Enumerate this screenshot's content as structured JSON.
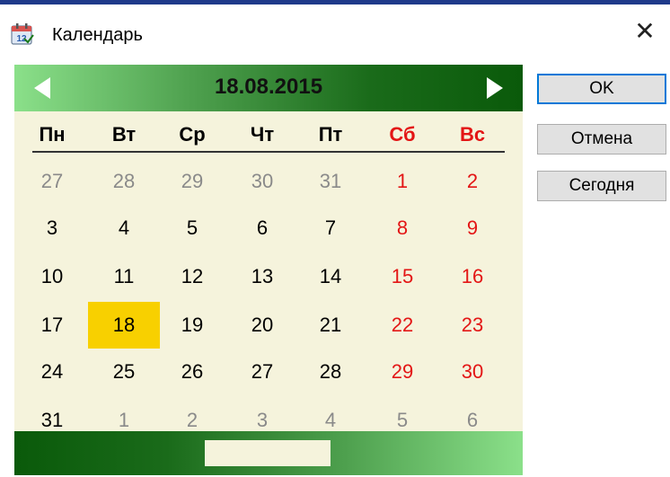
{
  "window": {
    "title": "Календарь",
    "close_glyph": "✕"
  },
  "calendar": {
    "current_date": "18.08.2015",
    "weekdays": [
      {
        "label": "Пн",
        "weekend": false
      },
      {
        "label": "Вт",
        "weekend": false
      },
      {
        "label": "Ср",
        "weekend": false
      },
      {
        "label": "Чт",
        "weekend": false
      },
      {
        "label": "Пт",
        "weekend": false
      },
      {
        "label": "Сб",
        "weekend": true
      },
      {
        "label": "Вс",
        "weekend": true
      }
    ],
    "weeks": [
      [
        "27",
        "28",
        "29",
        "30",
        "31",
        "1",
        "2"
      ],
      [
        "3",
        "4",
        "5",
        "6",
        "7",
        "8",
        "9"
      ],
      [
        "10",
        "11",
        "12",
        "13",
        "14",
        "15",
        "16"
      ],
      [
        "17",
        "18",
        "19",
        "20",
        "21",
        "22",
        "23"
      ],
      [
        "24",
        "25",
        "26",
        "27",
        "28",
        "29",
        "30"
      ],
      [
        "31",
        "1",
        "2",
        "3",
        "4",
        "5",
        "6"
      ]
    ],
    "other_month_cells": [
      [
        true,
        true,
        true,
        true,
        true,
        false,
        false
      ],
      [
        false,
        false,
        false,
        false,
        false,
        false,
        false
      ],
      [
        false,
        false,
        false,
        false,
        false,
        false,
        false
      ],
      [
        false,
        false,
        false,
        false,
        false,
        false,
        false
      ],
      [
        false,
        false,
        false,
        false,
        false,
        false,
        false
      ],
      [
        false,
        true,
        true,
        true,
        true,
        true,
        true
      ]
    ],
    "selected_day": "18",
    "colors": {
      "background": "#f5f3dc",
      "weekend": "#e31515",
      "other_month": "#8a8a8a",
      "selected": "#f8d000",
      "header_dark_green": "#0a5a0a",
      "header_light_green": "#8be08a"
    },
    "icons": {
      "prev": "triangle-left-icon",
      "next": "triangle-right-icon"
    }
  },
  "buttons": {
    "ok": "OK",
    "cancel": "Отмена",
    "today": "Сегодня"
  }
}
